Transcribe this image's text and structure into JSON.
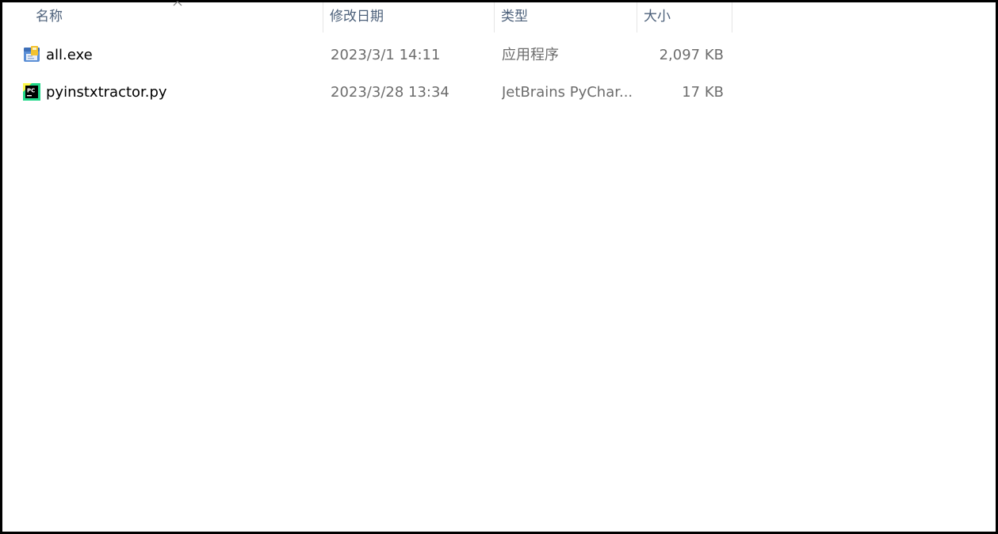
{
  "columns": {
    "name": "名称",
    "date": "修改日期",
    "type": "类型",
    "size": "大小"
  },
  "sort": {
    "column": "name",
    "icon": "chevron-up-icon"
  },
  "files": [
    {
      "name": "all.exe",
      "modified": "2023/3/1 14:11",
      "type": "应用程序",
      "size": "2,097 KB",
      "icon": "exe-app-icon"
    },
    {
      "name": "pyinstxtractor.py",
      "modified": "2023/3/28 13:34",
      "type": "JetBrains PyChar...",
      "size": "17 KB",
      "icon": "pycharm-icon"
    }
  ],
  "colors": {
    "header_text": "#4c607a",
    "secondary_text": "#6d6d6d",
    "primary_text": "#000000",
    "pycharm_green": "#21d789"
  }
}
